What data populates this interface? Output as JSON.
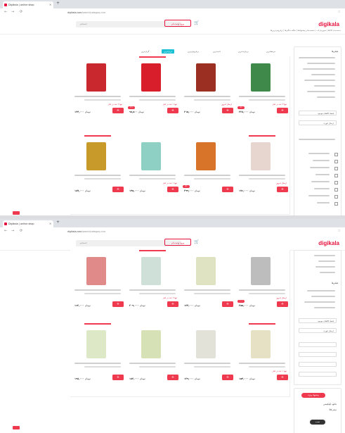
{
  "browser": {
    "tab_title": "Digikala | online shop",
    "new_tab": "+",
    "tab_close": "×",
    "nav": [
      "←",
      "→",
      "⟳"
    ],
    "url_prefix": "digikala.com",
    "url_rest": "/search/category-rice"
  },
  "header": {
    "logo": "digikala",
    "search_placeholder": "جستجو",
    "account_label": "ورود | ثبت‌نام",
    "menu": "دسته‌بندی کالاها | سوپرمارکت | تخفیف‌ها و پیشنهادها | شگفت‌انگیزها | پرفروش‌ترین‌ها"
  },
  "sort": {
    "items": [
      "مرتبط‌ترین",
      "پربازدیدترین",
      "جدیدترین",
      "پرفروش‌ترین",
      "ارزان‌ترین",
      "گران‌ترین"
    ],
    "active_index": 4
  },
  "colors": {
    "accent": "#ef394e",
    "active_tab": "#19bfd3"
  },
  "products_top": [
    {
      "img_color": "#c8282e",
      "stock": "تنها ۲ عدد در انبار",
      "price": "۱۲۴,۰۰۰",
      "discount": ""
    },
    {
      "img_color": "#d81e2a",
      "stock": "تنها ۱ عدد در انبار",
      "price": "۹۸,۵۰۰",
      "discount": "۱۲٪"
    },
    {
      "img_color": "#9b2f22",
      "stock": "ارسال امروز",
      "price": "۳۱۵,۰۰۰",
      "discount": ""
    },
    {
      "img_color": "#3f8a4a",
      "stock": "تنها ۳ عدد در انبار",
      "price": "۲۲۸,۰۰۰",
      "discount": "۸٪"
    },
    {
      "img_color": "#c79a2a",
      "stock": "",
      "price": "۱۸۷,۰۰۰",
      "discount": ""
    },
    {
      "img_color": "#8fd0c4",
      "stock": "تنها ۱ عدد در انبار",
      "price": "۱۴۵,۰۰۰",
      "discount": ""
    },
    {
      "img_color": "#d8742a",
      "stock": "",
      "price": "۲۹۹,۰۰۰",
      "discount": "۵٪"
    },
    {
      "img_color": "#e7d6d0",
      "stock": "ارسال امروز",
      "price": "۱۷۶,۰۰۰",
      "discount": ""
    }
  ],
  "products_bottom": [
    {
      "img_color": "#e08a8a",
      "stock": "",
      "price": "۱۶۲,۰۰۰",
      "discount": ""
    },
    {
      "img_color": "#cfe0d8",
      "stock": "تنها ۲ عدد در انبار",
      "price": "۲۰۹,۰۰۰",
      "discount": ""
    },
    {
      "img_color": "#dfe3c2",
      "stock": "",
      "price": "۱۳۴,۰۰۰",
      "discount": ""
    },
    {
      "img_color": "#bdbdbd",
      "stock": "ارسال امروز",
      "price": "۲۵۵,۰۰۰",
      "discount": "۱۰٪"
    },
    {
      "img_color": "#dce8c6",
      "stock": "",
      "price": "۱۹۸,۰۰۰",
      "discount": ""
    },
    {
      "img_color": "#d6e2b6",
      "stock": "",
      "price": "۱۸۳,۰۰۰",
      "discount": ""
    },
    {
      "img_color": "#e2e2d8",
      "stock": "",
      "price": "۱۲۹,۰۰۰",
      "discount": ""
    },
    {
      "img_color": "#e6e0c4",
      "stock": "تنها ۱ عدد در انبار",
      "price": "۱۵۴,۰۰۰",
      "discount": ""
    }
  ],
  "sidebar": {
    "filters_title": "فیلترها",
    "only_available": "فقط کالاهای موجود",
    "fast_delivery": "ارسال فوری"
  },
  "promo": {
    "badge": "پیشنهاد ویژه",
    "line1": "دانلود اپلیکیشن",
    "line2": "دیجی‌کالا",
    "button": "نصب"
  },
  "currency": "تومان",
  "add_symbol": "+"
}
